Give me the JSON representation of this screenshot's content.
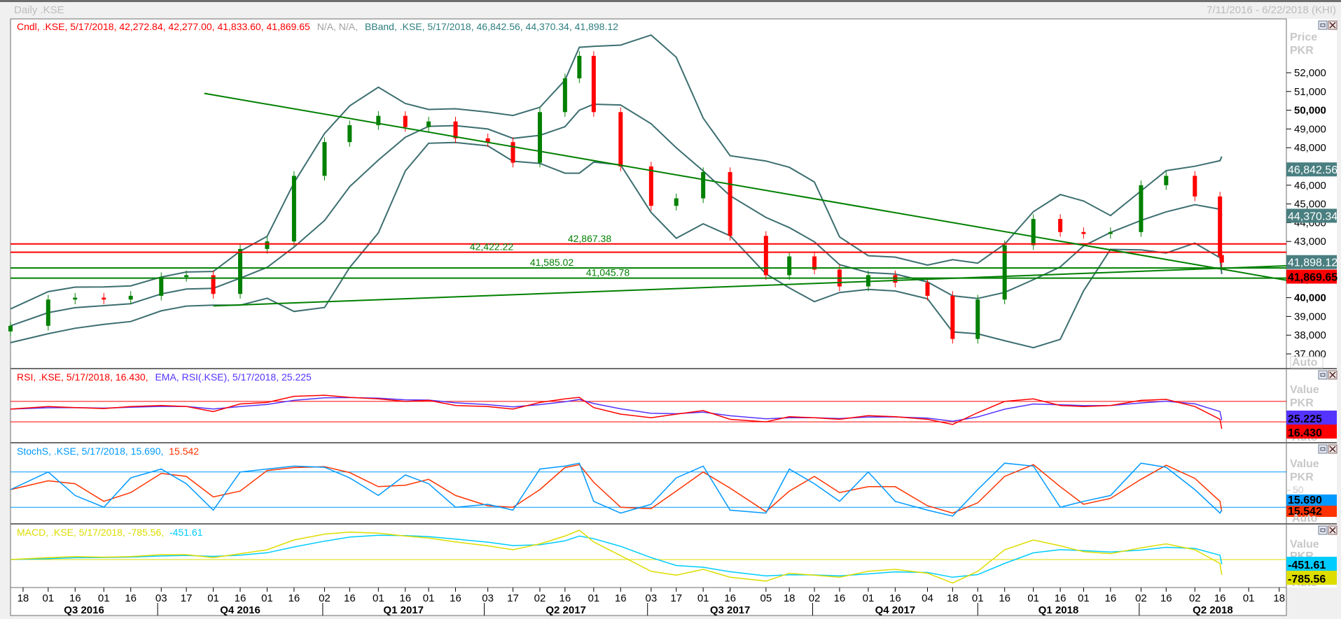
{
  "window": {
    "title": "Daily .KSE",
    "date_range": "7/11/2016 - 6/22/2018 (KHI)"
  },
  "price_panel": {
    "legend": {
      "cndl": "Cndl, .KSE, 5/17/2018, 42,272.84, 42,277.00, 41,833.60, 41,869.65",
      "na": "N/A, N/A,",
      "bband": "BBand, .KSE, 5/17/2018, 46,842.56, 44,370.34, 41,898.12"
    },
    "axis_title_1": "Price",
    "axis_title_2": "PKR",
    "auto_label": "Auto",
    "badges": [
      {
        "text": "46,842.56",
        "value": 46842.56,
        "color": "#4a7f80",
        "text_color": "#ffffff",
        "bold": false
      },
      {
        "text": "44,370.34",
        "value": 44370.34,
        "color": "#4a7f80",
        "text_color": "#ffffff",
        "bold": false
      },
      {
        "text": "41,898.12",
        "value": 41898.12,
        "color": "#4a7f80",
        "text_color": "#ffffff",
        "bold": false
      },
      {
        "text": "41,869.65",
        "value": 41869.65,
        "color": "#ff0000",
        "text_color": "#000000",
        "bold": true
      }
    ]
  },
  "rsi_panel": {
    "legend_rsi": "RSI, .KSE, 5/17/2018, 16.430,",
    "legend_ema": "EMA, RSI(.KSE), 5/17/2018, 25.225",
    "axis_title_1": "Value",
    "axis_title_2": "PKR",
    "auto_label": "Auto",
    "badges": [
      {
        "text": "25.225",
        "value": 25.225,
        "color": "#5533ff",
        "text_color": "#000000"
      },
      {
        "text": "16.430",
        "value": 16.43,
        "color": "#ff0000",
        "text_color": "#000000"
      }
    ]
  },
  "stoch_panel": {
    "legend_k": "StochS, .KSE, 5/17/2018, 15.690,",
    "legend_d": "15.542",
    "axis_title_1": "Value",
    "axis_title_2": "PKR",
    "tick_50": "50",
    "auto_label": "Auto",
    "badges": [
      {
        "text": "15.690",
        "value": 15.69,
        "color": "#0099ff",
        "text_color": "#000000"
      },
      {
        "text": "15.542",
        "value": 15.542,
        "color": "#ff3300",
        "text_color": "#000000"
      }
    ]
  },
  "macd_panel": {
    "legend_macd": "MACD, .KSE, 5/17/2018, -785.56,",
    "legend_signal": "-451.61",
    "axis_title_1": "Value",
    "axis_title_2": "PKR",
    "auto_label": "Auto",
    "badges": [
      {
        "text": "-451.61",
        "value": -451.61,
        "color": "#00ccff",
        "text_color": "#000000"
      },
      {
        "text": "-785.56",
        "value": -785.56,
        "color": "#dddd00",
        "text_color": "#000000"
      }
    ]
  },
  "colors": {
    "up": "#008000",
    "down": "#ff0000",
    "bband": "#3c6e70",
    "rsi": "#ff0000",
    "rsi_ema": "#5533ff",
    "stoch_k": "#0099ff",
    "stoch_d": "#ff3300",
    "macd": "#dddd00",
    "signal": "#00ccff",
    "hline_red": "#ff0000",
    "hline_green": "#008000"
  },
  "chart_data": {
    "type": "candlestick",
    "instrument": ".KSE",
    "x_range": [
      "2016-07-11",
      "2018-06-22"
    ],
    "y_range": [
      36500,
      53000
    ],
    "price_ticks": [
      37000,
      38000,
      39000,
      40000,
      41000,
      42000,
      43000,
      44000,
      45000,
      46000,
      47000,
      48000,
      49000,
      50000,
      51000,
      52000
    ],
    "price_tick_labels": [
      "37,000",
      "38,000",
      "39,000",
      "40,000",
      "41,000",
      "42,000",
      "43,000",
      "44,000",
      "45,000",
      "46,000",
      "47,000",
      "48,000",
      "49,000",
      "50,000",
      "51,000",
      "52,000"
    ],
    "dates": [
      "2016-07-11",
      "2016-08-01",
      "2016-08-16",
      "2016-09-01",
      "2016-09-16",
      "2016-10-03",
      "2016-10-17",
      "2016-11-01",
      "2016-11-16",
      "2016-12-01",
      "2016-12-16",
      "2017-01-02",
      "2017-01-16",
      "2017-02-01",
      "2017-02-16",
      "2017-03-01",
      "2017-03-16",
      "2017-04-03",
      "2017-04-17",
      "2017-05-02",
      "2017-05-16",
      "2017-05-24",
      "2017-06-01",
      "2017-06-16",
      "2017-07-03",
      "2017-07-17",
      "2017-08-01",
      "2017-08-16",
      "2017-09-05",
      "2017-09-18",
      "2017-10-02",
      "2017-10-16",
      "2017-11-01",
      "2017-11-16",
      "2017-12-04",
      "2017-12-18",
      "2018-01-01",
      "2018-01-16",
      "2018-02-01",
      "2018-02-16",
      "2018-03-01",
      "2018-03-16",
      "2018-04-02",
      "2018-04-16",
      "2018-05-02",
      "2018-05-16",
      "2018-05-17"
    ],
    "close": [
      38500,
      39900,
      40000,
      39900,
      40100,
      41100,
      41200,
      40200,
      42600,
      43000,
      46500,
      48300,
      49200,
      49700,
      49100,
      49400,
      48500,
      48300,
      47200,
      49900,
      51700,
      52900,
      49900,
      47000,
      44900,
      45300,
      46700,
      43300,
      41200,
      42200,
      41500,
      40600,
      41200,
      40800,
      40100,
      37800,
      39900,
      42800,
      44200,
      43500,
      43400,
      43500,
      46000,
      46500,
      45400,
      42200,
      41869.65
    ],
    "last_bar": {
      "date": "5/17/2018",
      "open": 42272.84,
      "high": 42277.0,
      "low": 41833.6,
      "close": 41869.65
    },
    "bband_last": {
      "upper": 46842.56,
      "middle": 44370.34,
      "lower": 41898.12
    },
    "horizontal_lines": [
      {
        "label": "42,867.38",
        "value": 42867.38,
        "color": "red"
      },
      {
        "label": "42,422.22",
        "value": 42422.22,
        "color": "red"
      },
      {
        "label": "41,585.02",
        "value": 41585.02,
        "color": "green"
      },
      {
        "label": "41,045.78",
        "value": 41045.78,
        "color": "green"
      }
    ],
    "trendlines": [
      {
        "from": [
          "2016-10-27",
          50900
        ],
        "to": [
          "2018-06-22",
          40930
        ]
      },
      {
        "from": [
          "2016-11-01",
          39560
        ],
        "to": [
          "2018-06-22",
          41700
        ]
      }
    ],
    "rsi": [
      55,
      60,
      58,
      56,
      60,
      62,
      60,
      50,
      65,
      68,
      80,
      82,
      78,
      75,
      70,
      72,
      62,
      60,
      55,
      68,
      75,
      78,
      58,
      45,
      38,
      45,
      52,
      35,
      30,
      40,
      38,
      35,
      42,
      40,
      35,
      25,
      48,
      70,
      75,
      62,
      60,
      62,
      72,
      74,
      60,
      35,
      16.43
    ],
    "rsi_levels": [
      70,
      30
    ],
    "stoch_k": [
      50,
      80,
      40,
      20,
      70,
      85,
      60,
      15,
      80,
      85,
      90,
      88,
      70,
      40,
      75,
      60,
      20,
      25,
      15,
      85,
      90,
      95,
      30,
      10,
      25,
      70,
      90,
      15,
      10,
      85,
      60,
      30,
      80,
      30,
      15,
      5,
      50,
      95,
      90,
      20,
      30,
      40,
      95,
      88,
      50,
      10,
      15.69
    ],
    "stoch_levels": [
      80,
      20
    ],
    "macd": [
      0,
      100,
      150,
      120,
      150,
      250,
      250,
      100,
      300,
      500,
      1000,
      1300,
      1400,
      1350,
      1200,
      1100,
      900,
      700,
      500,
      800,
      1200,
      1500,
      900,
      200,
      -600,
      -800,
      -500,
      -900,
      -1100,
      -700,
      -800,
      -900,
      -600,
      -500,
      -700,
      -1200,
      -600,
      500,
      1000,
      700,
      400,
      300,
      600,
      800,
      500,
      -200,
      -785.56
    ],
    "time_ticks": [
      [
        "2016-07-18",
        "18"
      ],
      [
        "2016-08-01",
        "01"
      ],
      [
        "2016-08-16",
        "16"
      ],
      [
        "2016-09-01",
        "01"
      ],
      [
        "2016-09-16",
        "16"
      ],
      [
        "2016-10-03",
        "03"
      ],
      [
        "2016-10-17",
        "17"
      ],
      [
        "2016-11-01",
        "01"
      ],
      [
        "2016-11-16",
        "16"
      ],
      [
        "2016-12-01",
        "01"
      ],
      [
        "2016-12-16",
        "16"
      ],
      [
        "2017-01-02",
        "02"
      ],
      [
        "2017-01-16",
        "16"
      ],
      [
        "2017-02-01",
        "01"
      ],
      [
        "2017-02-16",
        "16"
      ],
      [
        "2017-03-01",
        "01"
      ],
      [
        "2017-03-16",
        "16"
      ],
      [
        "2017-04-03",
        "03"
      ],
      [
        "2017-04-17",
        "17"
      ],
      [
        "2017-05-02",
        "02"
      ],
      [
        "2017-05-16",
        "16"
      ],
      [
        "2017-06-01",
        "01"
      ],
      [
        "2017-06-16",
        "16"
      ],
      [
        "2017-07-03",
        "03"
      ],
      [
        "2017-07-17",
        "17"
      ],
      [
        "2017-08-01",
        "01"
      ],
      [
        "2017-08-16",
        "16"
      ],
      [
        "2017-09-05",
        "05"
      ],
      [
        "2017-09-18",
        "18"
      ],
      [
        "2017-10-02",
        "02"
      ],
      [
        "2017-10-16",
        "16"
      ],
      [
        "2017-11-01",
        "01"
      ],
      [
        "2017-11-16",
        "16"
      ],
      [
        "2017-12-04",
        "04"
      ],
      [
        "2017-12-18",
        "18"
      ],
      [
        "2018-01-01",
        "01"
      ],
      [
        "2018-01-16",
        "16"
      ],
      [
        "2018-02-01",
        "01"
      ],
      [
        "2018-02-16",
        "16"
      ],
      [
        "2018-03-01",
        "01"
      ],
      [
        "2018-03-16",
        "16"
      ],
      [
        "2018-04-02",
        "02"
      ],
      [
        "2018-04-16",
        "16"
      ],
      [
        "2018-05-02",
        "02"
      ],
      [
        "2018-05-16",
        "16"
      ],
      [
        "2018-06-01",
        "01"
      ],
      [
        "2018-06-18",
        "18"
      ]
    ],
    "quarters": [
      [
        "2016-07-01",
        "Q3 2016"
      ],
      [
        "2016-10-01",
        "Q4 2016"
      ],
      [
        "2017-01-01",
        "Q1 2017"
      ],
      [
        "2017-04-01",
        "Q2 2017"
      ],
      [
        "2017-07-01",
        "Q3 2017"
      ],
      [
        "2017-10-01",
        "Q4 2017"
      ],
      [
        "2018-01-01",
        "Q1 2018"
      ],
      [
        "2018-04-01",
        "Q2 2018"
      ]
    ]
  }
}
